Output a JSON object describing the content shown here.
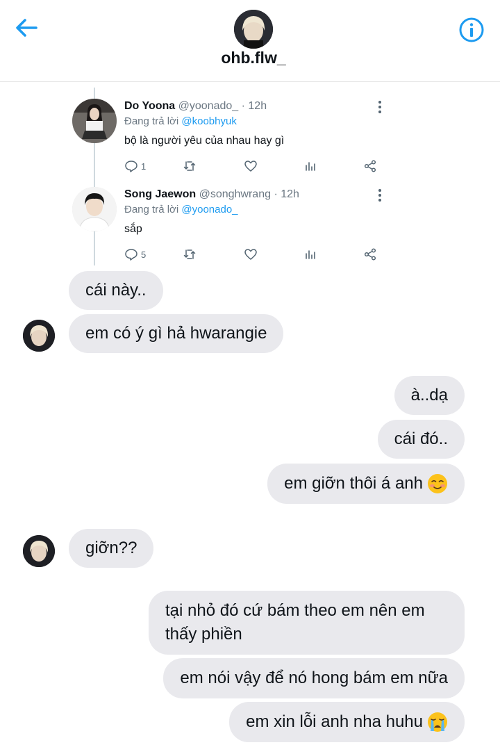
{
  "header": {
    "username": "ohb.flw_",
    "back_icon": "arrow-left-icon",
    "info_icon": "info-icon",
    "accent_color": "#1d9bf0"
  },
  "thread": {
    "tweets": [
      {
        "name": "Do Yoona",
        "handle": "@yoonado_",
        "time": "· 12h",
        "reply_prefix": "Đang trả lời",
        "reply_to": "@koobhyuk",
        "text": "bộ là người yêu của nhau hay gì",
        "reply_count": "1"
      },
      {
        "name": "Song Jaewon",
        "handle": "@songhwrang",
        "time": "· 12h",
        "reply_prefix": "Đang trả lời",
        "reply_to": "@yoonado_",
        "text": "sắp",
        "reply_count": "5"
      }
    ]
  },
  "messages": [
    {
      "side": "left",
      "text": "cái này.."
    },
    {
      "side": "left",
      "text": "em có ý gì hả hwarangie"
    },
    {
      "side": "right",
      "text": "à..dạ"
    },
    {
      "side": "right",
      "text": "cái đó.."
    },
    {
      "side": "right",
      "text": "em giỡn thôi á anh",
      "emoji": "smiling-blush-emoji"
    },
    {
      "side": "left",
      "text": "giỡn??"
    },
    {
      "side": "right",
      "text": "tại nhỏ đó cứ bám theo em nên em thấy phiền"
    },
    {
      "side": "right",
      "text": "em nói vậy để nó hong bám em nữa"
    },
    {
      "side": "right",
      "text": "em xin lỗi anh nha huhu",
      "emoji": "loudly-crying-emoji"
    }
  ]
}
